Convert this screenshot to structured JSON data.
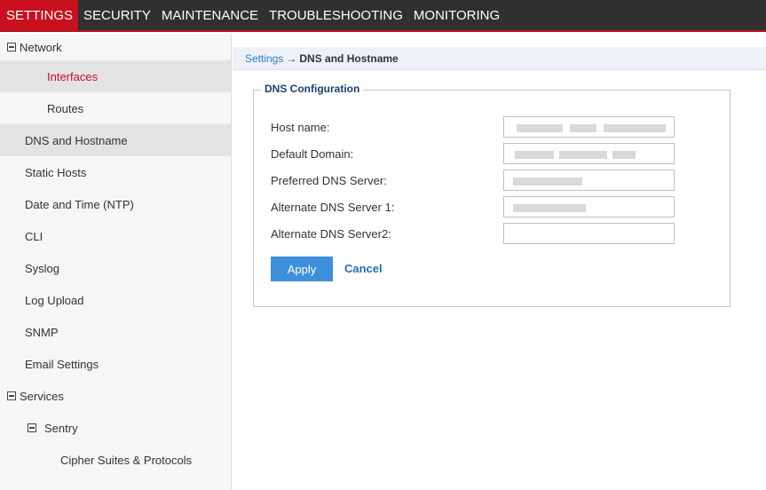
{
  "topnav": {
    "tabs": [
      {
        "label": "SETTINGS",
        "active": true
      },
      {
        "label": "SECURITY",
        "active": false
      },
      {
        "label": "MAINTENANCE",
        "active": false
      },
      {
        "label": "TROUBLESHOOTING",
        "active": false
      },
      {
        "label": "MONITORING",
        "active": false
      }
    ]
  },
  "sidebar": {
    "network_group": "Network",
    "interfaces": "Interfaces",
    "routes": "Routes",
    "dns_hostname": "DNS and Hostname",
    "static_hosts": "Static Hosts",
    "date_time": "Date and Time (NTP)",
    "cli": "CLI",
    "syslog": "Syslog",
    "log_upload": "Log Upload",
    "snmp": "SNMP",
    "email_settings": "Email Settings",
    "services_group": "Services",
    "sentry_group": "Sentry",
    "cipher_suites": "Cipher Suites & Protocols"
  },
  "breadcrumb": {
    "parent": "Settings",
    "separator": "→",
    "current": "DNS and Hostname"
  },
  "dns_config": {
    "legend": "DNS Configuration",
    "host_name_label": "Host name:",
    "default_domain_label": "Default Domain:",
    "preferred_dns_label": "Preferred DNS Server:",
    "alternate_dns1_label": "Alternate DNS Server 1:",
    "alternate_dns2_label": "Alternate DNS Server2:",
    "apply_label": "Apply",
    "cancel_label": "Cancel"
  },
  "colors": {
    "accent_red": "#c8101e",
    "nav_bg": "#303030",
    "apply_blue": "#3d8fd9",
    "link_blue": "#2f7fc4"
  }
}
